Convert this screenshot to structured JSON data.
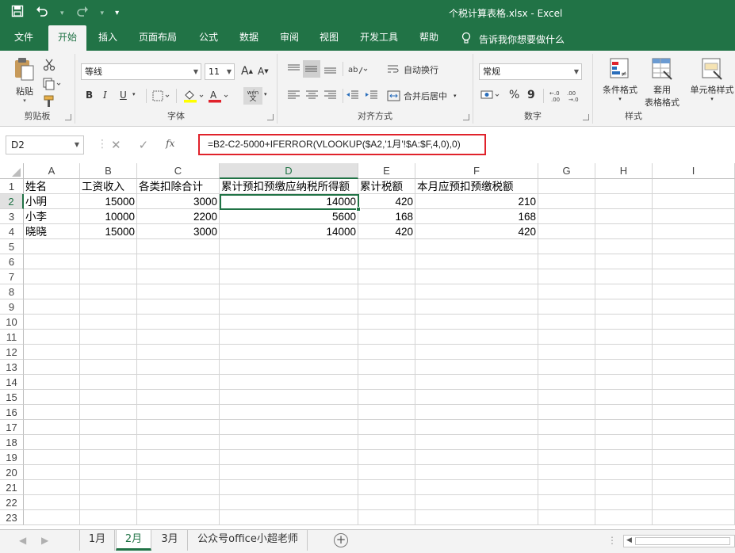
{
  "window": {
    "title": "个税计算表格.xlsx  -  Excel"
  },
  "qat": {
    "save_icon": "save-icon",
    "undo_icon": "undo-icon",
    "redo_icon": "redo-icon",
    "customize": "▾"
  },
  "tabs": [
    {
      "label": "文件"
    },
    {
      "label": "开始"
    },
    {
      "label": "插入"
    },
    {
      "label": "页面布局"
    },
    {
      "label": "公式"
    },
    {
      "label": "数据"
    },
    {
      "label": "审阅"
    },
    {
      "label": "视图"
    },
    {
      "label": "开发工具"
    },
    {
      "label": "帮助"
    }
  ],
  "tellme": {
    "label": "告诉我你想要做什么"
  },
  "ribbon": {
    "clipboard": {
      "paste": "粘贴",
      "label": "剪贴板"
    },
    "font": {
      "name": "等线",
      "size": "11",
      "label": "字体",
      "bold": "B",
      "italic": "I",
      "underline": "U",
      "grow": "A",
      "shrink": "A",
      "wen": "wén",
      "wen2": "文"
    },
    "align": {
      "wrap": "自动换行",
      "merge": "合并后居中",
      "label": "对齐方式"
    },
    "number": {
      "format": "常规",
      "label": "数字",
      "percent": "%",
      "comma": "9",
      "inc": "←.0",
      "dec": ".00"
    },
    "styles": {
      "cond": "条件格式",
      "table1": "套用",
      "table2": "表格格式",
      "cell": "单元格样式",
      "label": "样式"
    }
  },
  "formula_bar": {
    "name_box": "D2",
    "fx": "fx",
    "formula": "=B2-C2-5000+IFERROR(VLOOKUP($A2,'1月'!$A:$F,4,0),0)"
  },
  "columns": [
    "A",
    "B",
    "C",
    "D",
    "E",
    "F",
    "G",
    "H",
    "I"
  ],
  "rows": [
    "1",
    "2",
    "3",
    "4",
    "5",
    "6",
    "7",
    "8",
    "9",
    "10",
    "11",
    "12",
    "13",
    "14",
    "15",
    "16",
    "17",
    "18",
    "19",
    "20",
    "21",
    "22",
    "23"
  ],
  "cells": {
    "r1": [
      "姓名",
      "工资收入",
      "各类扣除合计",
      "累计预扣预缴应纳税所得额",
      "累计税额",
      "本月应预扣预缴税额"
    ],
    "r2": [
      "小明",
      "15000",
      "3000",
      "14000",
      "420",
      "210"
    ],
    "r3": [
      "小李",
      "10000",
      "2200",
      "5600",
      "168",
      "168"
    ],
    "r4": [
      "晓晓",
      "15000",
      "3000",
      "14000",
      "420",
      "420"
    ]
  },
  "sheets": [
    {
      "label": "1月"
    },
    {
      "label": "2月"
    },
    {
      "label": "3月"
    },
    {
      "label": "公众号office小超老师"
    }
  ],
  "sheet_nav": {
    "prev": "◀",
    "next": "▶",
    "add": "+",
    "more": "⋮"
  }
}
